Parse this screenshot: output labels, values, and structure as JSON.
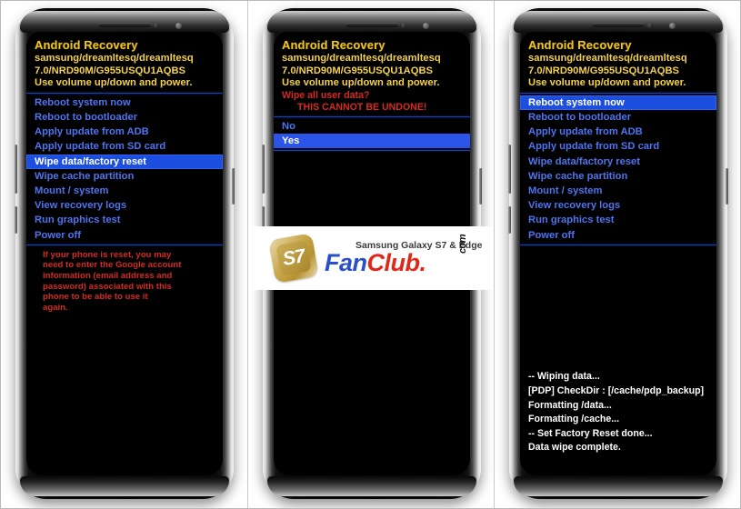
{
  "common": {
    "title": "Android Recovery",
    "device_line": "samsung/dreamltesq/dreamltesq",
    "build_line": "7.0/NRD90M/G955USQU1AQBS",
    "instruction": "Use volume up/down and power.",
    "menu": [
      "Reboot system now",
      "Reboot to bootloader",
      "Apply update from ADB",
      "Apply update from SD card",
      "Wipe data/factory reset",
      "Wipe cache partition",
      "Mount / system",
      "View recovery logs",
      "Run graphics test",
      "Power off"
    ],
    "colors": {
      "title_yellow": "#f0c419",
      "menu_blue": "#4f74ee",
      "highlight_blue": "#1c4fe0",
      "warning_red": "#d42a22",
      "screen_black": "#000000"
    }
  },
  "panel1": {
    "selected_index": 4,
    "warning_lines": [
      "If your phone is reset, you may",
      "need to enter the Google account",
      "information (email address and",
      "password) associated with this",
      "phone to be able to use it",
      "again."
    ]
  },
  "panel2": {
    "question": "Wipe all user data?",
    "warning": "THIS CANNOT BE UNDONE!",
    "choices": [
      "No",
      "Yes"
    ],
    "selected_index": 1
  },
  "panel3": {
    "selected_index": 0,
    "log_lines": [
      "-- Wiping data...",
      "[PDP] CheckDir : [/cache/pdp_backup]",
      "Formatting /data...",
      "Formatting /cache...",
      "-- Set Factory Reset done...",
      "Data wipe complete."
    ]
  },
  "watermark": {
    "logo_text": "S7",
    "tagline": "Samsung Galaxy S7 & Edge",
    "brand_part1": "Fan",
    "brand_part2": "Club.",
    "brand_tld": "com"
  }
}
